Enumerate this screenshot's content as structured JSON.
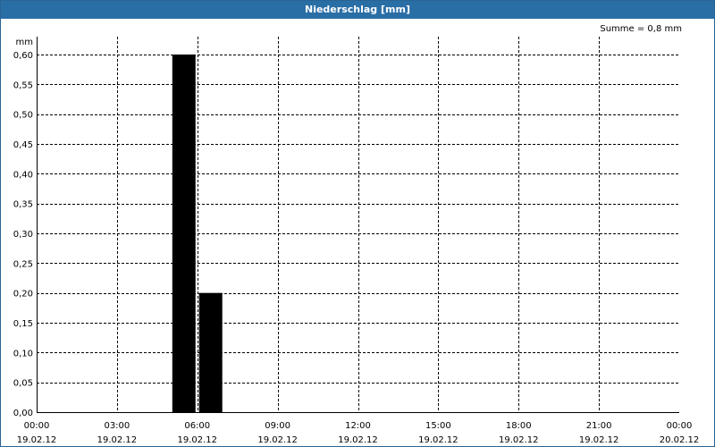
{
  "window": {
    "title": "Niederschlag [mm]"
  },
  "summary": {
    "text": "Summe = 0,8 mm"
  },
  "chart_data": {
    "type": "bar",
    "title": "Niederschlag [mm]",
    "ylabel": "mm",
    "ylim": [
      0,
      0.6
    ],
    "yticks": [
      "0,00",
      "0,05",
      "0,10",
      "0,15",
      "0,20",
      "0,25",
      "0,30",
      "0,35",
      "0,40",
      "0,45",
      "0,50",
      "0,55",
      "0,60"
    ],
    "xlim_hours": [
      0,
      24
    ],
    "xticks": [
      {
        "time": "00:00",
        "date": "19.02.12"
      },
      {
        "time": "03:00",
        "date": "19.02.12"
      },
      {
        "time": "06:00",
        "date": "19.02.12"
      },
      {
        "time": "09:00",
        "date": "19.02.12"
      },
      {
        "time": "12:00",
        "date": "19.02.12"
      },
      {
        "time": "15:00",
        "date": "19.02.12"
      },
      {
        "time": "18:00",
        "date": "19.02.12"
      },
      {
        "time": "21:00",
        "date": "19.02.12"
      },
      {
        "time": "00:00",
        "date": "20.02.12"
      }
    ],
    "bars": [
      {
        "start_hour": 5,
        "end_hour": 6,
        "value": 0.6
      },
      {
        "start_hour": 6,
        "end_hour": 7,
        "value": 0.2
      }
    ],
    "grid": true,
    "bar_color": "#000000"
  }
}
